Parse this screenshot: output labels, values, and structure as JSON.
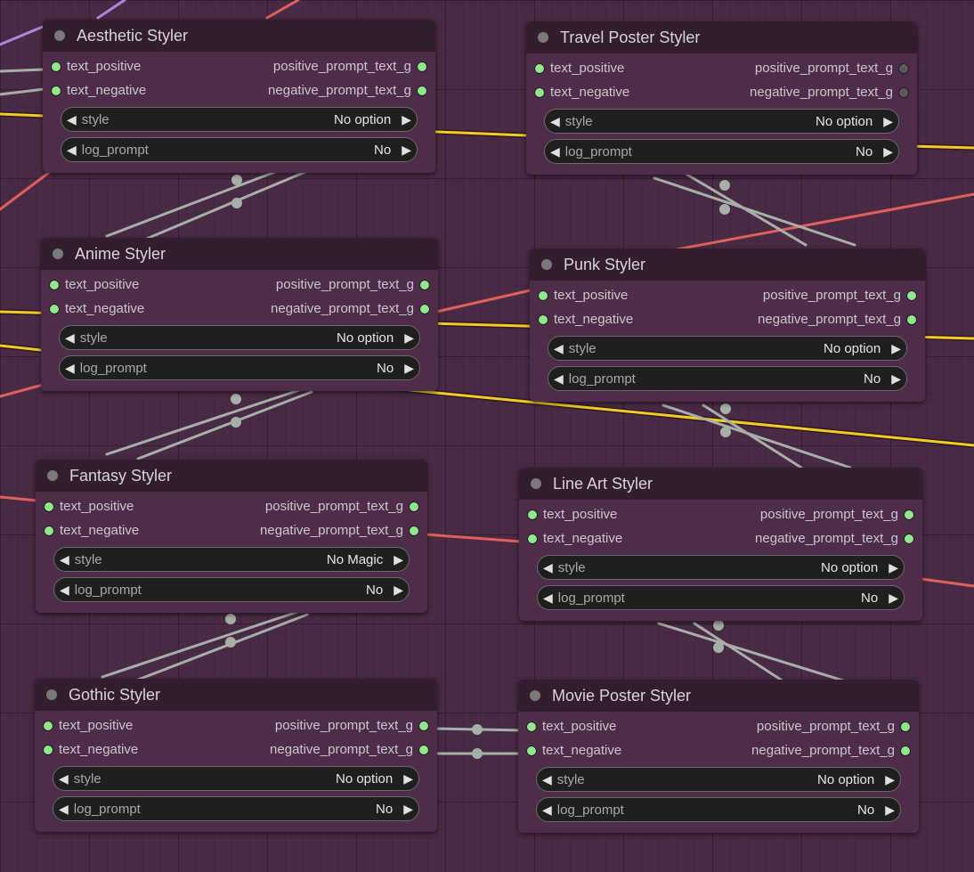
{
  "colors": {
    "canvas": "#4a2a45",
    "node_body": "#4f2d4a",
    "node_header": "#331e30",
    "slot_connected": "#8fe88a",
    "wire_gray": "#a7b0a7",
    "wire_yellow": "#f2cc22",
    "wire_red": "#e0605e",
    "wire_purple": "#a88ad8"
  },
  "nodes": [
    {
      "title": "Aesthetic Styler",
      "inputs": [
        "text_positive",
        "text_negative"
      ],
      "outputs": [
        "positive_prompt_text_g",
        "negative_prompt_text_g"
      ],
      "outputs_connected": true,
      "style_label": "style",
      "style_value": "No option",
      "log_label": "log_prompt",
      "log_value": "No"
    },
    {
      "title": "Travel Poster Styler",
      "inputs": [
        "text_positive",
        "text_negative"
      ],
      "outputs": [
        "positive_prompt_text_g",
        "negative_prompt_text_g"
      ],
      "outputs_connected": false,
      "style_label": "style",
      "style_value": "No option",
      "log_label": "log_prompt",
      "log_value": "No"
    },
    {
      "title": "Anime Styler",
      "inputs": [
        "text_positive",
        "text_negative"
      ],
      "outputs": [
        "positive_prompt_text_g",
        "negative_prompt_text_g"
      ],
      "outputs_connected": true,
      "style_label": "style",
      "style_value": "No option",
      "log_label": "log_prompt",
      "log_value": "No"
    },
    {
      "title": "Punk Styler",
      "inputs": [
        "text_positive",
        "text_negative"
      ],
      "outputs": [
        "positive_prompt_text_g",
        "negative_prompt_text_g"
      ],
      "outputs_connected": true,
      "style_label": "style",
      "style_value": "No option",
      "log_label": "log_prompt",
      "log_value": "No"
    },
    {
      "title": "Fantasy Styler",
      "inputs": [
        "text_positive",
        "text_negative"
      ],
      "outputs": [
        "positive_prompt_text_g",
        "negative_prompt_text_g"
      ],
      "outputs_connected": true,
      "style_label": "style",
      "style_value": "No Magic",
      "log_label": "log_prompt",
      "log_value": "No"
    },
    {
      "title": "Line Art Styler",
      "inputs": [
        "text_positive",
        "text_negative"
      ],
      "outputs": [
        "positive_prompt_text_g",
        "negative_prompt_text_g"
      ],
      "outputs_connected": true,
      "style_label": "style",
      "style_value": "No option",
      "log_label": "log_prompt",
      "log_value": "No"
    },
    {
      "title": "Gothic Styler",
      "inputs": [
        "text_positive",
        "text_negative"
      ],
      "outputs": [
        "positive_prompt_text_g",
        "negative_prompt_text_g"
      ],
      "outputs_connected": true,
      "style_label": "style",
      "style_value": "No option",
      "log_label": "log_prompt",
      "log_value": "No"
    },
    {
      "title": "Movie Poster Styler",
      "inputs": [
        "text_positive",
        "text_negative"
      ],
      "outputs": [
        "positive_prompt_text_g",
        "negative_prompt_text_g"
      ],
      "outputs_connected": true,
      "style_label": "style",
      "style_value": "No option",
      "log_label": "log_prompt",
      "log_value": "No"
    }
  ]
}
